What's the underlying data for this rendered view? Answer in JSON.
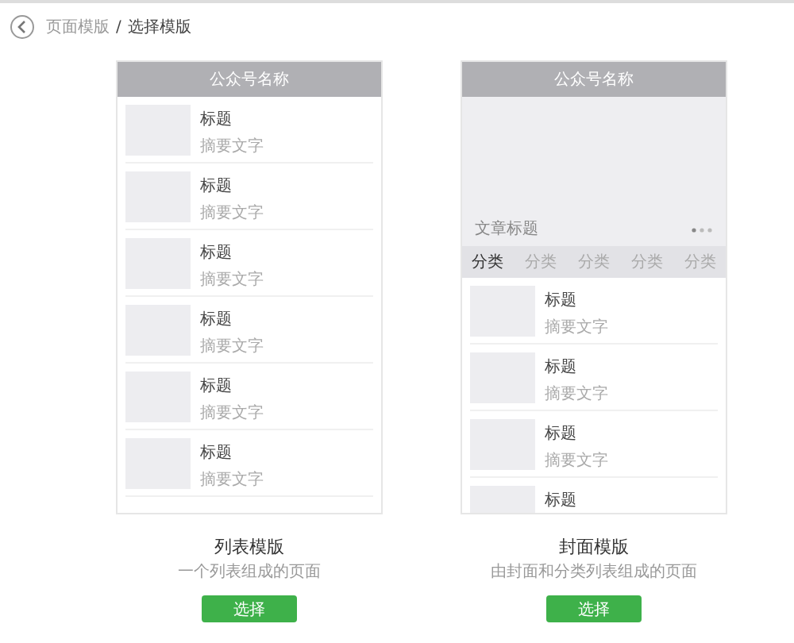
{
  "breadcrumb": {
    "parent": "页面模版",
    "separator": "/",
    "current": "选择模版"
  },
  "templates": [
    {
      "kind": "list",
      "header": "公众号名称",
      "articles": [
        {
          "title": "标题",
          "summary": "摘要文字"
        },
        {
          "title": "标题",
          "summary": "摘要文字"
        },
        {
          "title": "标题",
          "summary": "摘要文字"
        },
        {
          "title": "标题",
          "summary": "摘要文字"
        },
        {
          "title": "标题",
          "summary": "摘要文字"
        },
        {
          "title": "标题",
          "summary": "摘要文字"
        }
      ],
      "name": "列表模版",
      "description": "一个列表组成的页面",
      "button": "选择"
    },
    {
      "kind": "cover",
      "header": "公众号名称",
      "cover_title": "文章标题",
      "tabs": [
        {
          "label": "分类",
          "selected": true
        },
        {
          "label": "分类",
          "selected": false
        },
        {
          "label": "分类",
          "selected": false
        },
        {
          "label": "分类",
          "selected": false
        },
        {
          "label": "分类",
          "selected": false
        }
      ],
      "articles": [
        {
          "title": "标题",
          "summary": "摘要文字"
        },
        {
          "title": "标题",
          "summary": "摘要文字"
        },
        {
          "title": "标题",
          "summary": "摘要文字"
        },
        {
          "title": "标题"
        }
      ],
      "name": "封面模版",
      "description": "由封面和分类列表组成的页面",
      "button": "选择"
    }
  ]
}
